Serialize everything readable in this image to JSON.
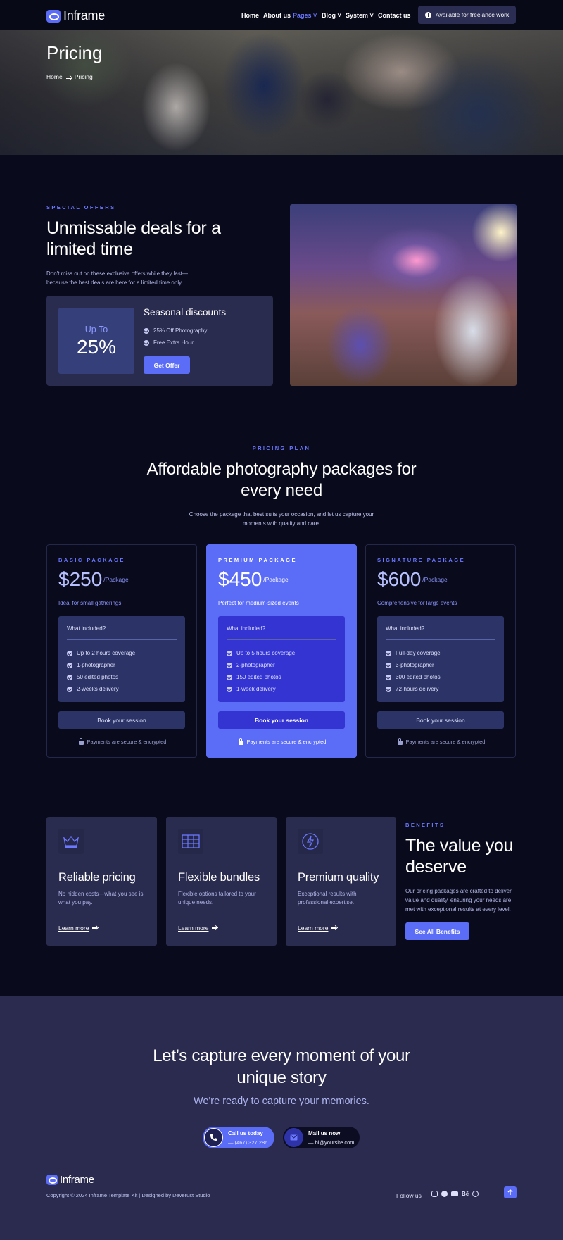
{
  "header": {
    "logo_text": "Inframe",
    "nav": [
      {
        "label": "Home"
      },
      {
        "label": "About us"
      },
      {
        "label": "Pages"
      },
      {
        "label": "Blog"
      },
      {
        "label": "System"
      },
      {
        "label": "Contact us"
      }
    ],
    "cta_label": "Available for freelance work",
    "accent_color": "#5b6cf6"
  },
  "hero": {
    "title": "Pricing",
    "breadcrumb": [
      "Home",
      "Pricing"
    ]
  },
  "offers": {
    "eyebrow": "SPECIAL OFFERS",
    "title": "Unmissable deals for a limited time",
    "description": "Don't miss out on these exclusive offers while they last—because the best deals are here for a limited time only.",
    "badge_prefix": "Up To",
    "badge_value": "25%",
    "card_title": "Seasonal discounts",
    "items": [
      "25% Off Photography",
      "Free Extra Hour"
    ],
    "button": "Get Offer"
  },
  "pricing": {
    "eyebrow": "PRICING PLAN",
    "title": "Affordable photography packages for every need",
    "description": "Choose the package that best suits your occasion, and let us capture your moments with quality and care.",
    "included_label": "What included?",
    "button": "Book your session",
    "secure_note": "Payments are secure & encrypted",
    "per": "/Package",
    "plans": [
      {
        "name": "BASIC PACKAGE",
        "price": "$250",
        "subtitle": "Ideal for small gatherings",
        "features": [
          "Up to 2 hours coverage",
          "1-photographer",
          "50 edited photos",
          "2-weeks delivery"
        ]
      },
      {
        "name": "PREMIUM PACKAGE",
        "price": "$450",
        "subtitle": "Perfect for medium-sized events",
        "features": [
          "Up to 5 hours coverage",
          "2-photographer",
          "150 edited photos",
          "1-week delivery"
        ]
      },
      {
        "name": "SIGNATURE PACKAGE",
        "price": "$600",
        "subtitle": "Comprehensive for large events",
        "features": [
          "Full-day coverage",
          "3-photographer",
          "300 edited photos",
          "72-hours delivery"
        ]
      }
    ]
  },
  "features": {
    "link_label": "Learn more",
    "items": [
      {
        "icon": "crown-icon",
        "title": "Reliable pricing",
        "description": "No hidden costs—what you see is what you pay."
      },
      {
        "icon": "grid-icon",
        "title": "Flexible bundles",
        "description": "Flexible options tailored to your unique needs."
      },
      {
        "icon": "lightning-icon",
        "title": "Premium quality",
        "description": "Exceptional results with professional expertise."
      }
    ]
  },
  "benefits": {
    "eyebrow": "BENEFITS",
    "title": "The value you deserve",
    "description": "Our pricing packages are crafted to deliver value and quality, ensuring your needs are met with exceptional results at every level.",
    "button": "See All Benefits"
  },
  "cta": {
    "title": "Let’s capture every moment of your unique story",
    "subtitle": "We're ready to capture your memories.",
    "call_label": "Call us today",
    "call_value": "— (467) 327 286",
    "mail_label": "Mail us now",
    "mail_value": "— hi@yoursite.com"
  },
  "footer": {
    "logo_text": "Inframe",
    "copyright": "Copyright © 2024 Inframe Template Kit | Designed by Deverust Studio",
    "follow_label": "Follow us",
    "socials": [
      "instagram-icon",
      "facebook-icon",
      "youtube-icon",
      "Bē",
      "dribbble-icon"
    ]
  }
}
